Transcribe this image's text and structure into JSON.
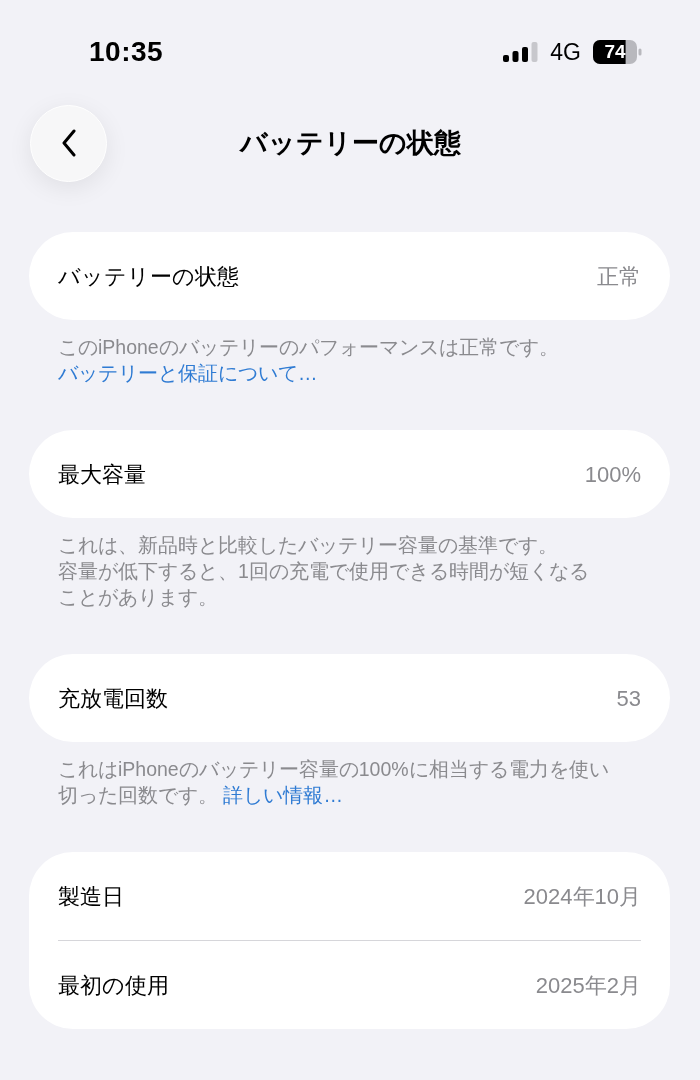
{
  "status_bar": {
    "time": "10:35",
    "network": "4G",
    "battery": "74"
  },
  "nav": {
    "title": "バッテリーの状態"
  },
  "sections": [
    {
      "rows": [
        {
          "label": "バッテリーの状態",
          "value": "正常"
        }
      ],
      "footer": {
        "text": "このiPhoneのバッテリーのパフォーマンスは正常です。",
        "link": "バッテリーと保証について…"
      }
    },
    {
      "rows": [
        {
          "label": "最大容量",
          "value": "100%"
        }
      ],
      "footer": {
        "text": "これは、新品時と比較したバッテリー容量の基準です。容量が低下すると、1回の充電で使用できる時間が短くなることがあります。"
      }
    },
    {
      "rows": [
        {
          "label": "充放電回数",
          "value": "53"
        }
      ],
      "footer": {
        "text": "これはiPhoneのバッテリー容量の100%に相当する電力を使い切った回数です。 ",
        "link": "詳しい情報…"
      }
    },
    {
      "rows": [
        {
          "label": "製造日",
          "value": "2024年10月"
        },
        {
          "label": "最初の使用",
          "value": "2025年2月"
        }
      ]
    }
  ]
}
